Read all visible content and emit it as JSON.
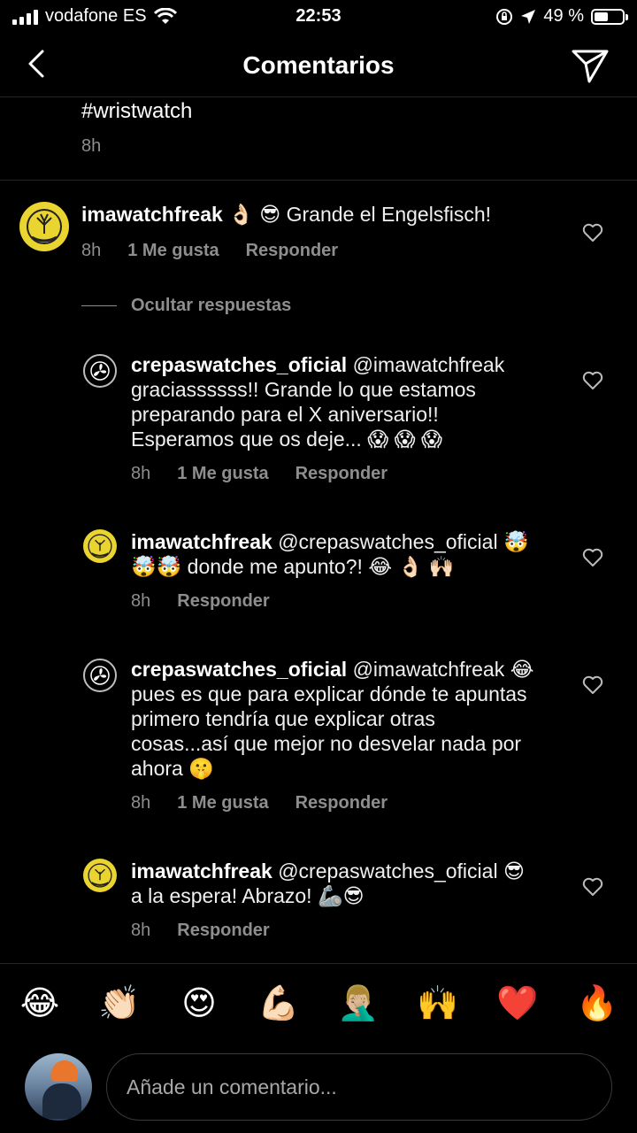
{
  "status_bar": {
    "carrier": "vodafone ES",
    "time": "22:53",
    "battery": "49 %",
    "battery_level": 0.49
  },
  "header": {
    "title": "Comentarios"
  },
  "caption": {
    "text": "#wristwatch",
    "time": "8h"
  },
  "comments": [
    {
      "user": "imawatchfreak",
      "text": "👌🏻 😎  Grande el Engelsfisch!",
      "time": "8h",
      "likes": "1 Me gusta",
      "reply_label": "Responder"
    }
  ],
  "hide_replies_label": "Ocultar respuestas",
  "replies": [
    {
      "user": "crepaswatches_oficial",
      "text": "@imawatchfreak gracias​sssss!! Grande lo que estamos preparando para el X aniversario!! Esperamos que os deje... 😱 😱 😱",
      "time": "8h",
      "likes": "1 Me gusta",
      "reply_label": "Responder"
    },
    {
      "user": "imawatchfreak",
      "text": "@crepaswatches_oficial 🤯🤯🤯 donde me apunto?! 😂 👌🏻 🙌🏻",
      "time": "8h",
      "reply_label": "Responder"
    },
    {
      "user": "crepaswatches_oficial",
      "text": "@imawatchfreak 😂 pues es que para explicar dónde te apuntas primero tendría que explicar otras cosas...así que mejor no desvelar nada por ahora 🤫",
      "time": "8h",
      "likes": "1 Me gusta",
      "reply_label": "Responder"
    },
    {
      "user": "imawatchfreak",
      "text": "@crepaswatches_oficial 😎 a la espera! Abrazo! 🦾😎",
      "time": "8h",
      "reply_label": "Responder"
    }
  ],
  "emoji_bar": [
    "😂",
    "👏🏻",
    "😍",
    "💪🏻",
    "🤦🏼‍♂️",
    "🙌",
    "❤️",
    "🔥"
  ],
  "compose": {
    "placeholder": "Añade un comentario..."
  }
}
